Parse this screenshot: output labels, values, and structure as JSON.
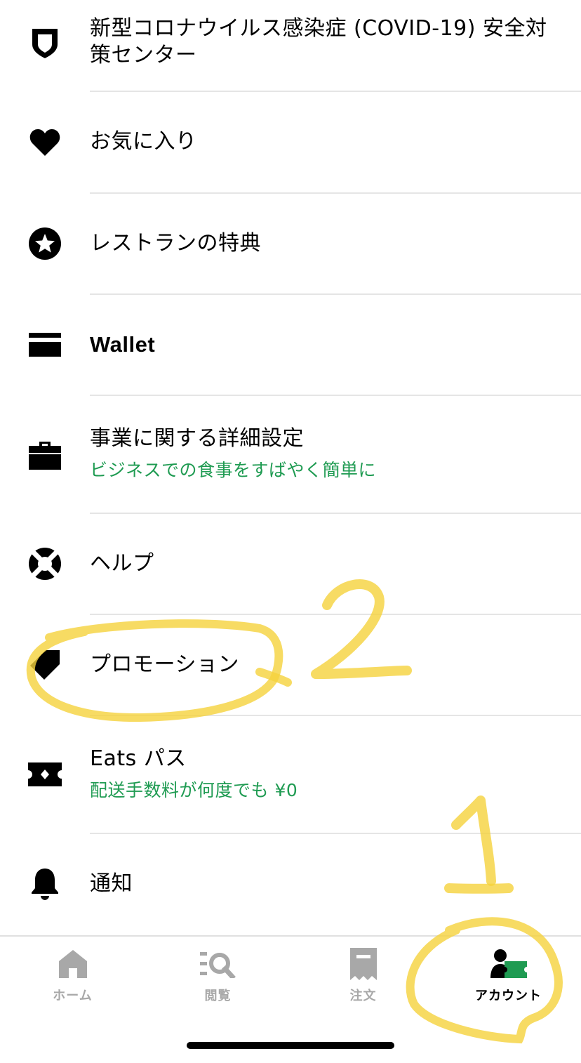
{
  "menu": {
    "items": [
      {
        "icon": "shield-icon",
        "label": "新型コロナウイルス感染症 (COVID-19) 安全対策センター",
        "sub": ""
      },
      {
        "icon": "heart-icon",
        "label": "お気に入り",
        "sub": ""
      },
      {
        "icon": "star-icon",
        "label": "レストランの特典",
        "sub": ""
      },
      {
        "icon": "wallet-icon",
        "label": "Wallet",
        "sub": ""
      },
      {
        "icon": "briefcase-icon",
        "label": "事業に関する詳細設定",
        "sub": "ビジネスでの食事をすばやく簡単に"
      },
      {
        "icon": "lifebuoy-icon",
        "label": "ヘルプ",
        "sub": ""
      },
      {
        "icon": "tag-icon",
        "label": "プロモーション",
        "sub": ""
      },
      {
        "icon": "ticket-icon",
        "label": "Eats パス",
        "sub": "配送手数料が何度でも ¥0"
      },
      {
        "icon": "bell-icon",
        "label": "通知",
        "sub": ""
      }
    ]
  },
  "tabbar": {
    "tabs": [
      {
        "icon": "home-icon",
        "label": "ホーム",
        "active": false
      },
      {
        "icon": "browse-icon",
        "label": "閲覧",
        "active": false
      },
      {
        "icon": "receipt-icon",
        "label": "注文",
        "active": false
      },
      {
        "icon": "account-icon",
        "label": "アカウント",
        "active": true
      }
    ]
  },
  "annotations": {
    "marks": [
      "2",
      "1"
    ],
    "color": "#f5d23c"
  },
  "colors": {
    "accent": "#1f9b52",
    "inactive_tab": "#a8a8a8",
    "divider": "#e5e5e5"
  }
}
